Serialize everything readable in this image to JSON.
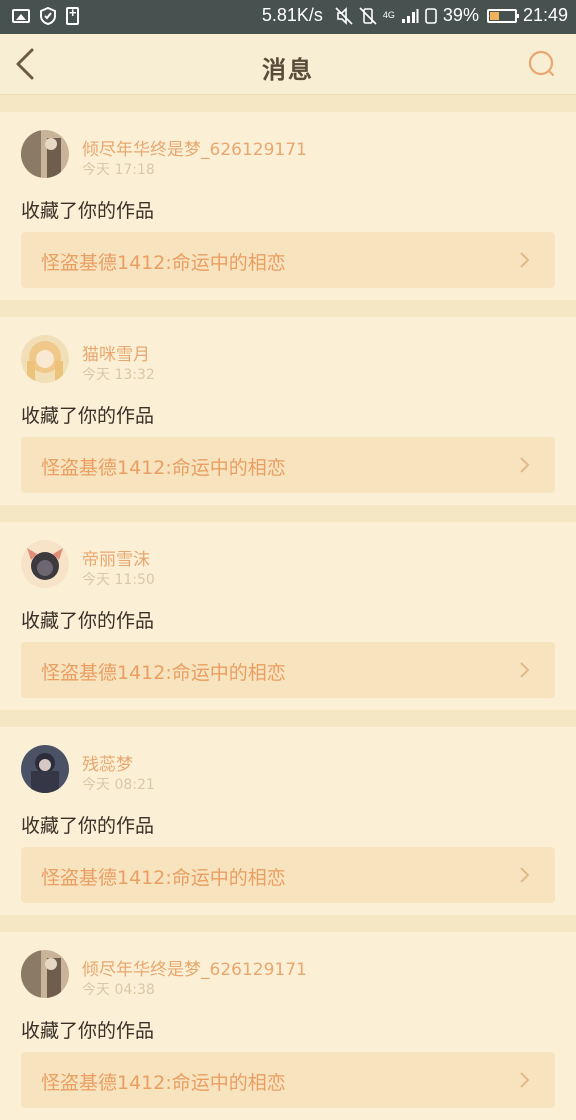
{
  "status_bar": {
    "network_speed": "5.81K/s",
    "network_type": "4G",
    "battery_percent": "39%",
    "battery_level": 0.39,
    "time": "21:49"
  },
  "header": {
    "title": "消息"
  },
  "messages": [
    {
      "username": "倾尽年华终是梦_626129171",
      "time": "今天 17:18",
      "action": "收藏了你的作品",
      "work_title": "怪盗基德1412:命运中的相恋"
    },
    {
      "username": "猫咪雪月",
      "time": "今天 13:32",
      "action": "收藏了你的作品",
      "work_title": "怪盗基德1412:命运中的相恋"
    },
    {
      "username": "帝丽雪沫",
      "time": "今天 11:50",
      "action": "收藏了你的作品",
      "work_title": "怪盗基德1412:命运中的相恋"
    },
    {
      "username": "残蕊梦",
      "time": "今天 08:21",
      "action": "收藏了你的作品",
      "work_title": "怪盗基德1412:命运中的相恋"
    },
    {
      "username": "倾尽年华终是梦_626129171",
      "time": "今天 04:38",
      "action": "收藏了你的作品",
      "work_title": "怪盗基德1412:命运中的相恋"
    }
  ],
  "colors": {
    "accent": "#e8a76f",
    "background": "#f7ecd0",
    "status_bar": "#465150"
  }
}
